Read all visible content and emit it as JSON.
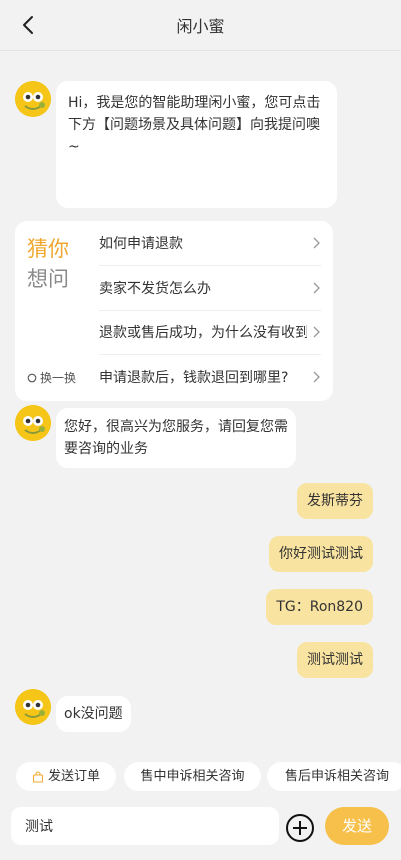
{
  "header": {
    "title": "闲小蜜"
  },
  "messages": {
    "welcome": "Hi，我是您的智能助理闲小蜜，您可点击下方【问题场景及具体问题】向我提问噢~",
    "greeting": "您好，很高兴为您服务，请回复您需要咨询的业务",
    "user_1": "发斯蒂芬",
    "user_2": "你好测试测试",
    "user_3": "TG：Ron820",
    "user_4": "测试测试",
    "bot_reply": "ok没问题"
  },
  "guess": {
    "title_line1": "猜你",
    "title_line2": "想问",
    "refresh_label": "换一换",
    "questions": [
      "如何申请退款",
      "卖家不发货怎么办",
      "退款或售后成功，为什么没有收到退款",
      "申请退款后，钱款退回到哪里?"
    ]
  },
  "quick_actions": {
    "send_order": "发送订单",
    "in_sale": "售中申诉相关咨询",
    "after_sale": "售后申诉相关咨询"
  },
  "input": {
    "value": "测试",
    "send_label": "发送"
  },
  "colors": {
    "bubble_user": "#f8e3a0",
    "accent": "#f6c04a",
    "guess_orange": "#f0a830"
  }
}
